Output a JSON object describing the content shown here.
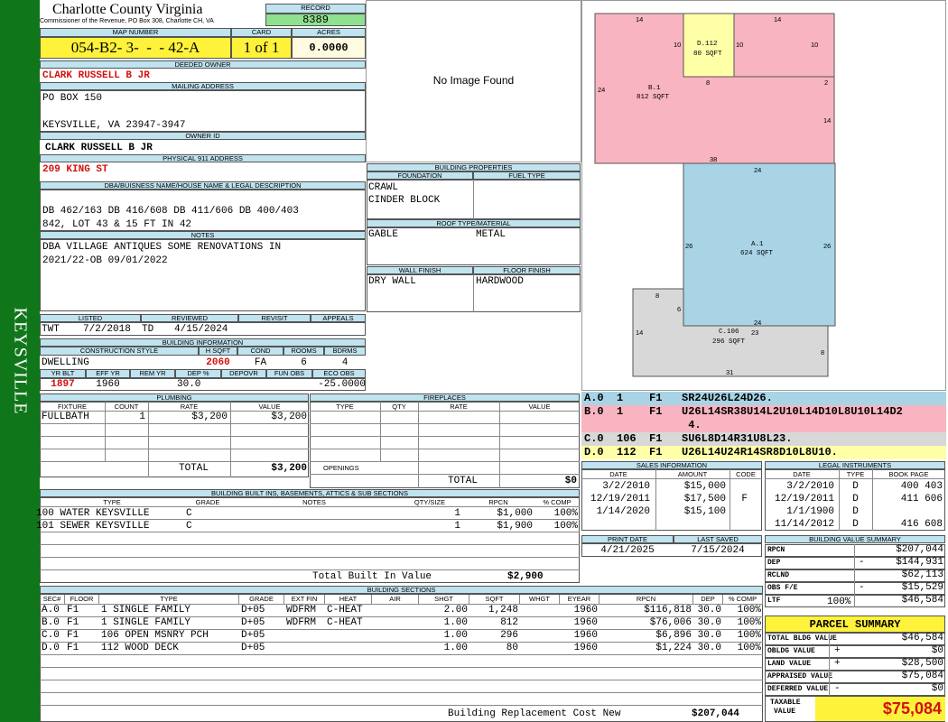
{
  "side_label": "KEYSVILLE",
  "county": {
    "name": "Charlotte County Virginia",
    "address": "Commissioner of the Revenue, PO Box 308, Charlotte CH, VA"
  },
  "record": {
    "label": "RECORD",
    "value": "8389"
  },
  "map": {
    "label": "MAP NUMBER",
    "value": "054-B2- 3-  -  - 42-A"
  },
  "card": {
    "label": "CARD",
    "value": "1 of 1"
  },
  "acres": {
    "label": "ACRES",
    "value": "0.0000"
  },
  "owner": {
    "deeded_label": "DEEDED OWNER",
    "deeded": "CLARK RUSSELL B JR",
    "mailing_label": "MAILING ADDRESS",
    "mail1": "PO BOX 150",
    "mail2": "KEYSVILLE, VA 23947-3947",
    "id_label": "OWNER ID",
    "id_value": "CLARK RUSSELL B JR",
    "phys_label": "PHYSICAL 911 ADDRESS",
    "phys": "209 KING ST"
  },
  "legal": {
    "label": "DBA/BUISNESS NAME/HOUSE NAME & LEGAL DESCRIPTION",
    "line1": "DB 462/163 DB 416/608 DB 411/606 DB 400/403",
    "line2": "842, LOT 43 & 15 FT IN 42"
  },
  "notes": {
    "label": "NOTES",
    "line1": "DBA VILLAGE ANTIQUES SOME RENOVATIONS IN",
    "line2": "2021/22-OB 09/01/2022"
  },
  "image_text": "No Image Found",
  "props": {
    "label": "BUILDING PROPERTIES",
    "found_label": "FOUNDATION",
    "fuel_label": "FUEL TYPE",
    "found1": "CRAWL",
    "found2": "CINDER BLOCK",
    "roof_label": "ROOF TYPE/MATERIAL",
    "roof_type": "GABLE",
    "roof_mat": "METAL",
    "wall_label": "WALL FINISH",
    "floor_label": "FLOOR FINISH",
    "wall": "DRY WALL",
    "floor": "HARDWOOD"
  },
  "review": {
    "listed_label": "LISTED",
    "reviewed_label": "REVIEWED",
    "revisit_label": "REVISIT",
    "appeals_label": "APPEALS",
    "listed_by": "TWT",
    "listed": "7/2/2018",
    "reviewed_by": "TD",
    "reviewed": "4/15/2024"
  },
  "info": {
    "label": "BUILDING INFORMATION",
    "style_label": "CONSTRUCTION STYLE",
    "hsqft_label": "H SQFT",
    "cond_label": "COND",
    "rooms_label": "ROOMS",
    "bdrms_label": "BDRMS",
    "style": "DWELLING",
    "hsqft": "2060",
    "cond": "FA",
    "rooms": "6",
    "bdrms": "4",
    "yr_label": "YR BLT",
    "eff_label": "EFF YR",
    "rem_label": "REM YR",
    "dep_label": "DEP %",
    "depovr_label": "DEPOVR",
    "fun_label": "FUN OBS",
    "eco_label": "ECO OBS",
    "yr": "1897",
    "eff": "1960",
    "dep": "30.0",
    "eco": "-25.0000"
  },
  "plumbing": {
    "label": "PLUMBING",
    "h_fixture": "FIXTURE",
    "h_count": "COUNT",
    "h_rate": "RATE",
    "h_value": "VALUE",
    "fixture": "FULLBATH",
    "count": "1",
    "rate": "$3,200",
    "value": "$3,200",
    "total_label": "TOTAL",
    "total": "$3,200"
  },
  "fireplaces": {
    "label": "FIREPLACES",
    "h_type": "TYPE",
    "h_qty": "QTY",
    "h_rate": "RATE",
    "h_value": "VALUE",
    "openings": "OPENINGS",
    "total_label": "TOTAL",
    "total": "$0"
  },
  "builtins": {
    "label": "BUILDING BUILT INS, BASEMENTS, ATTICS & SUB SECTIONS",
    "h_type": "TYPE",
    "h_grade": "GRADE",
    "h_notes": "NOTES",
    "h_qty": "QTY/SIZE",
    "h_rpcn": "RPCN",
    "h_comp": "% COMP",
    "rows": [
      {
        "type": "100 WATER KEYSVILLE",
        "grade": "C",
        "qty": "1",
        "rpcn": "$1,000",
        "comp": "100%"
      },
      {
        "type": "101 SEWER KEYSVILLE",
        "grade": "C",
        "qty": "1",
        "rpcn": "$1,900",
        "comp": "100%"
      }
    ],
    "total_label": "Total Built In Value",
    "total": "$2,900"
  },
  "sections": {
    "label": "BUILDING SECTIONS",
    "h_sec": "SEC#",
    "h_floor": "FLOOR",
    "h_type": "TYPE",
    "h_grade": "GRADE",
    "h_ext": "EXT FIN",
    "h_heat": "HEAT",
    "h_air": "AIR",
    "h_shgt": "SHGT",
    "h_sqft": "SQFT",
    "h_whgt": "WHGT",
    "h_eyear": "EYEAR",
    "h_rpcn": "RPCN",
    "h_dep": "DEP",
    "h_comp": "% COMP",
    "rows": [
      {
        "sec": "A.0",
        "floor": "F1",
        "type": "1 SINGLE FAMILY",
        "grade": "D+05",
        "ext": "WDFRM",
        "heat": "C-HEAT",
        "shgt": "2.00",
        "sqft": "1,248",
        "eyear": "1960",
        "rpcn": "$116,818",
        "dep": "30.0",
        "comp": "100%"
      },
      {
        "sec": "B.0",
        "floor": "F1",
        "type": "1 SINGLE FAMILY",
        "grade": "D+05",
        "ext": "WDFRM",
        "heat": "C-HEAT",
        "shgt": "1.00",
        "sqft": "812",
        "eyear": "1960",
        "rpcn": "$76,006",
        "dep": "30.0",
        "comp": "100%"
      },
      {
        "sec": "C.0",
        "floor": "F1",
        "type": "106 OPEN MSNRY PCH",
        "grade": "D+05",
        "ext": "",
        "heat": "",
        "shgt": "1.00",
        "sqft": "296",
        "eyear": "1960",
        "rpcn": "$6,896",
        "dep": "30.0",
        "comp": "100%"
      },
      {
        "sec": "D.0",
        "floor": "F1",
        "type": "112 WOOD DECK",
        "grade": "D+05",
        "ext": "",
        "heat": "",
        "shgt": "1.00",
        "sqft": "80",
        "eyear": "1960",
        "rpcn": "$1,224",
        "dep": "30.0",
        "comp": "100%"
      }
    ],
    "brc_label": "Building Replacement Cost New",
    "brc": "$207,044"
  },
  "sketch": {
    "b_label": "B.1",
    "b_area": "812 SqFt",
    "d_label": "D.112",
    "d_area": "80 SqFt",
    "a_label": "A.1",
    "a_area": "624 SqFt",
    "c_label": "C.106",
    "c_area": "296 SqFt",
    "dims": {
      "b_top_l": "14",
      "b_top_r": "14",
      "d_l": "10",
      "d_r": "10",
      "b_r1": "10",
      "b_left": "24",
      "d_bot": "8",
      "b_step": "2",
      "b_right": "14",
      "b_bot": "38",
      "a_top": "24",
      "a_left": "26",
      "a_right": "26",
      "a_bot": "24",
      "c_top": "8",
      "c_step": "6",
      "c_left": "14",
      "c_23": "23",
      "c_right": "8",
      "c_bot": "31"
    }
  },
  "codes": [
    {
      "text": "A.0  1    F1   SR24U26L24D26.",
      "color": "#a8d4e6"
    },
    {
      "text": "B.0  1    F1   U26L14SR38U14L2U10L14D10L8U10L14D2",
      "color": "#f8b4c0"
    },
    {
      "text": "                4.",
      "color": "#f8b4c0"
    },
    {
      "text": "C.0  106  F1   SU6L8D14R31U8L23.",
      "color": "#d8d8d8"
    },
    {
      "text": "D.0  112  F1   U26L14U24R14SR8D10L8U10.",
      "color": "#ffffa8"
    }
  ],
  "sales": {
    "label": "SALES INFORMATION",
    "h_date": "DATE",
    "h_amount": "AMOUNT",
    "h_code": "CODE",
    "rows": [
      {
        "date": "3/2/2010",
        "amount": "$15,000",
        "code": ""
      },
      {
        "date": "12/19/2011",
        "amount": "$17,500",
        "code": "F"
      },
      {
        "date": "1/14/2020",
        "amount": "$15,100",
        "code": ""
      }
    ]
  },
  "legal_inst": {
    "label": "LEGAL INSTRUMENTS",
    "h_date": "DATE",
    "h_type": "TYPE",
    "h_book": "BOOK PAGE",
    "rows": [
      {
        "date": "3/2/2010",
        "type": "D",
        "book": "400 403"
      },
      {
        "date": "12/19/2011",
        "type": "D",
        "book": "411 606"
      },
      {
        "date": "1/1/1900",
        "type": "D",
        "book": ""
      },
      {
        "date": "11/14/2012",
        "type": "D",
        "book": "416 608"
      }
    ]
  },
  "print": {
    "print_label": "PRINT DATE",
    "saved_label": "LAST SAVED",
    "print": "4/21/2025",
    "saved": "7/15/2024"
  },
  "bvs": {
    "label": "BUILDING VALUE SUMMARY",
    "rows": [
      {
        "k": "RPCN",
        "s": "",
        "v": "$207,044"
      },
      {
        "k": "DEP",
        "s": "-",
        "v": "$144,931"
      },
      {
        "k": "RCLND",
        "s": "",
        "v": "$62,113"
      },
      {
        "k": "OBS F/E",
        "s": "-",
        "v": "$15,529"
      },
      {
        "k": "LTF",
        "s": "",
        "v": "$46,584"
      }
    ],
    "ltf_pct": "100%"
  },
  "parcel": {
    "label": "PARCEL SUMMARY",
    "rows": [
      {
        "k": "TOTAL BLDG VALUE",
        "s": "",
        "v": "$46,584"
      },
      {
        "k": "OBLDG VALUE",
        "s": "+",
        "v": "$0"
      },
      {
        "k": "LAND VALUE",
        "s": "+",
        "v": "$28,500"
      },
      {
        "k": "APPRAISED VALUE",
        "s": "",
        "v": "$75,084"
      },
      {
        "k": "DEFERRED VALUE",
        "s": "-",
        "v": "$0"
      }
    ],
    "taxable_label1": "TAXABLE",
    "taxable_label2": "VALUE",
    "taxable": "$75,084"
  }
}
